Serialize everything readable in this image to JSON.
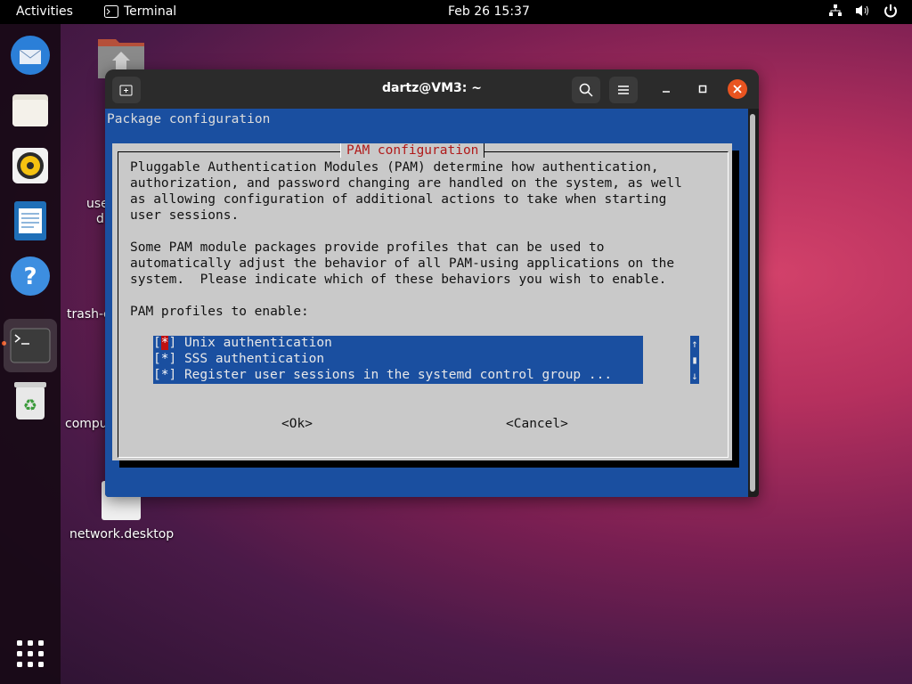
{
  "topbar": {
    "activities": "Activities",
    "app_name": "Terminal",
    "clock": "Feb 26  15:37"
  },
  "desktop": {
    "icons": [
      {
        "label": "use",
        "label2": "d"
      },
      {
        "label": "trash-c"
      },
      {
        "label": "compu"
      },
      {
        "label": "network.desktop"
      }
    ]
  },
  "terminal": {
    "title": "dartz@VM3: ~",
    "header_text": "Package configuration",
    "dialog": {
      "title": "PAM configuration",
      "para1": [
        "Pluggable Authentication Modules (PAM) determine how authentication,",
        "authorization, and password changing are handled on the system, as well",
        "as allowing configuration of additional actions to take when starting",
        "user sessions."
      ],
      "para2": [
        "Some PAM module packages provide profiles that can be used to",
        "automatically adjust the behavior of all PAM-using applications on the",
        "system.  Please indicate which of these behaviors you wish to enable."
      ],
      "prompt": "PAM profiles to enable:",
      "options": [
        {
          "mark": "*",
          "label": "Unix authentication",
          "checked": true
        },
        {
          "mark": "*",
          "label": "SSS authentication",
          "checked": true
        },
        {
          "mark": "*",
          "label": "Register user sessions in the systemd control group ...",
          "checked": true
        }
      ],
      "scroll_up": "↑",
      "scroll_mid": "▮",
      "scroll_down": "↓",
      "ok_label": "<Ok>",
      "cancel_label": "<Cancel>"
    }
  },
  "colors": {
    "accent": "#e95420",
    "terminal_bg": "#1a4fa0",
    "dialog_bg": "#c9c9c9",
    "dialog_title": "#b01a1a"
  }
}
